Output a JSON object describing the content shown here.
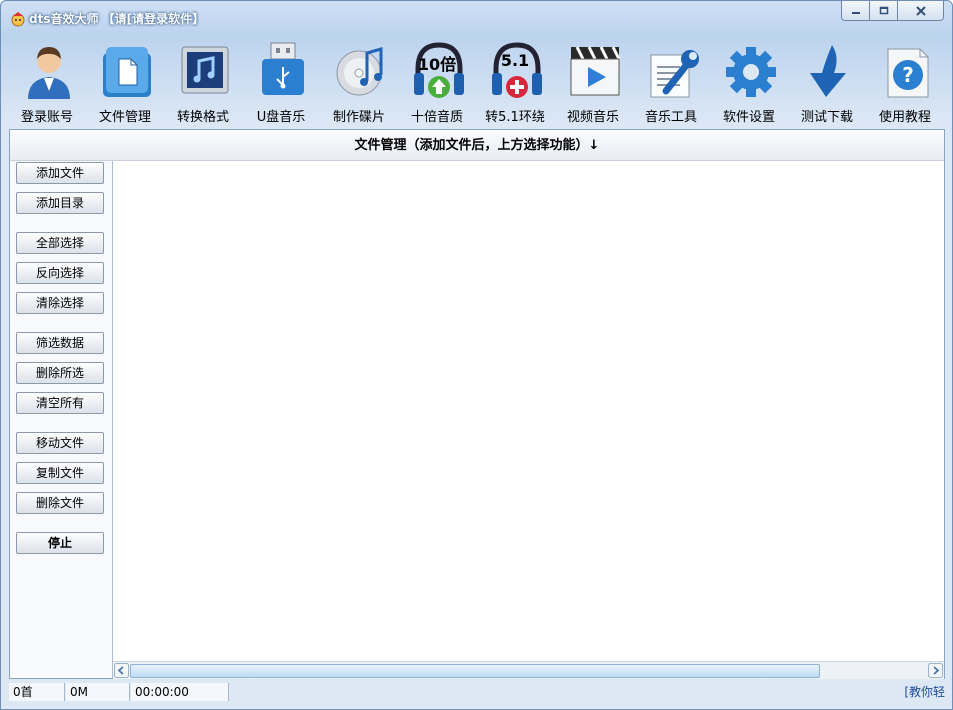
{
  "window": {
    "title": "dts音效大师 【请[请登录软件】",
    "controls": {
      "minimize_icon": "minimize-icon",
      "maximize_icon": "maximize-icon",
      "close_icon": "close-icon"
    }
  },
  "toolbar": {
    "items": [
      {
        "label": "登录账号",
        "icon": "user-icon"
      },
      {
        "label": "文件管理",
        "icon": "folder-icon"
      },
      {
        "label": "转换格式",
        "icon": "music-note-icon"
      },
      {
        "label": "U盘音乐",
        "icon": "usb-drive-icon"
      },
      {
        "label": "制作碟片",
        "icon": "disc-icon"
      },
      {
        "label": "十倍音质",
        "icon": "headphones-up-icon",
        "badge": "10倍"
      },
      {
        "label": "转5.1环绕",
        "icon": "headphones-plus-icon",
        "badge": "5.1"
      },
      {
        "label": "视频音乐",
        "icon": "video-icon"
      },
      {
        "label": "音乐工具",
        "icon": "wrench-icon"
      },
      {
        "label": "软件设置",
        "icon": "gear-icon"
      },
      {
        "label": "测试下载",
        "icon": "download-arrow-icon"
      },
      {
        "label": "使用教程",
        "icon": "help-icon"
      }
    ]
  },
  "section": {
    "title": "文件管理（添加文件后，上方选择功能）↓"
  },
  "sidebar": {
    "add_file": "添加文件",
    "add_dir": "添加目录",
    "select_all": "全部选择",
    "invert_select": "反向选择",
    "clear_select": "清除选择",
    "filter_data": "筛选数据",
    "delete_selected": "删除所选",
    "clear_all": "清空所有",
    "move_file": "移动文件",
    "copy_file": "复制文件",
    "delete_file": "删除文件",
    "stop": "停止"
  },
  "status": {
    "count": "0首",
    "size": "0M",
    "duration": "00:00:00",
    "link": "[教你轻"
  },
  "colors": {
    "accent": "#2f6fbd",
    "window_bg": "#dde8f5",
    "border": "#8ea3bd"
  }
}
